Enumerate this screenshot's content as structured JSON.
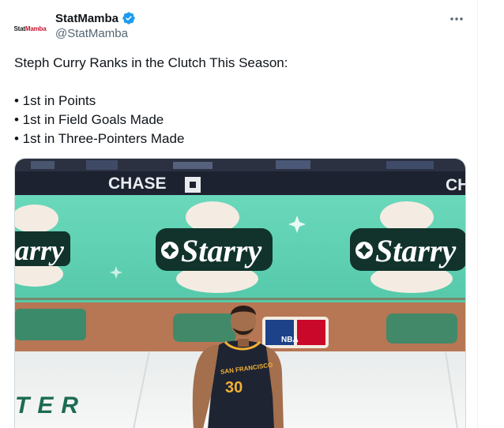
{
  "author": {
    "display_name": "StatMamba",
    "handle": "@StatMamba",
    "avatar_logo": {
      "main": "Stat",
      "accent": "Mamba"
    },
    "verified": true
  },
  "tweet": {
    "headline": "Steph Curry Ranks in the Clutch This Season:",
    "bullets": [
      "• 1st in Points",
      "• 1st in Field Goals Made",
      "• 1st in Three-Pointers Made"
    ]
  },
  "media": {
    "sponsor_text": "CHASE",
    "sponsor_text_partial": "CH",
    "banner_text": "Starry",
    "banner_text_left_partial": "arry",
    "jersey_city": "SAN FRANCISCO",
    "jersey_number": "30",
    "league_logo_text": "NBA",
    "court_text": "TER"
  },
  "colors": {
    "brand_accent": "#c8102e",
    "verified_blue": "#1d9bf0",
    "banner_teal": "#5fd3b3",
    "banner_dark": "#11332c",
    "jersey_navy": "#1f2433",
    "jersey_gold": "#f2b134"
  }
}
